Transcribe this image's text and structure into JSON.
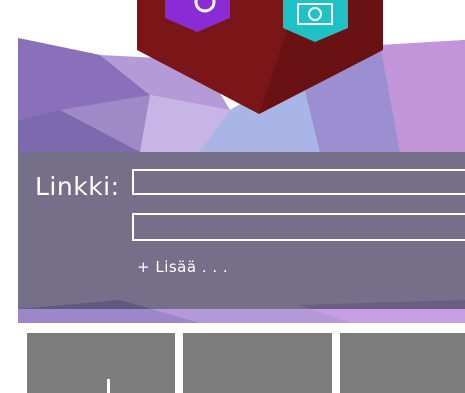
{
  "link_form": {
    "label": "Linkki:",
    "fields": [
      {
        "value": "",
        "placeholder": ""
      },
      {
        "value": "",
        "placeholder": ""
      }
    ],
    "add_more": "+ Lisää . . ."
  },
  "icons": {
    "top_left": "purple-app-icon",
    "top_right": "camera-icon"
  },
  "colors": {
    "header_red": "#7a1518",
    "icon_purple": "#8b2bd6",
    "icon_teal": "#1fc2c4",
    "panel": "#544b6c",
    "tile_gray": "#7c7c7c"
  }
}
